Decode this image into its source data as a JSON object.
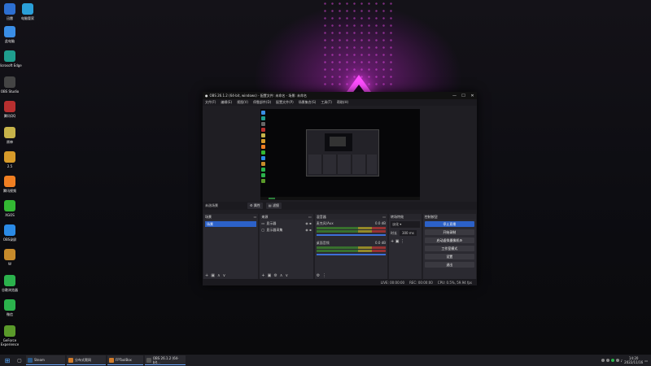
{
  "desktop": {
    "icons": [
      {
        "label": "此电脑",
        "color": "#3a8ee6"
      },
      {
        "label": "Microsoft Edge",
        "color": "#1f9e8e"
      },
      {
        "label": "OBS Studio",
        "color": "#444444"
      },
      {
        "label": "腾讯QQ",
        "color": "#b72f2f"
      },
      {
        "label": "原神",
        "color": "#c7b34a"
      },
      {
        "label": "2.5",
        "color": "#d79b2a"
      },
      {
        "label": "腾讯视频",
        "color": "#f07f22"
      },
      {
        "label": "XGOS",
        "color": "#33b833"
      },
      {
        "label": "OBS录屏",
        "color": "#2b8be6"
      },
      {
        "label": "W",
        "color": "#c78b2b"
      },
      {
        "label": "谷歌浏览器",
        "color": "#2bb24c"
      },
      {
        "label": "微信",
        "color": "#2bb24c"
      },
      {
        "label": "GeForce Experience",
        "color": "#5a9a2a"
      }
    ],
    "top_icons": [
      {
        "label": "迅雷",
        "color": "#2d6fd1"
      },
      {
        "label": "电脑管家",
        "color": "#2a9fd8"
      }
    ]
  },
  "obs": {
    "title": "OBS 26.1.2 (64-bit, windows) - 配置文件: 未命名 - 场景: 未命名",
    "window_controls": [
      "—",
      "☐",
      "✕"
    ],
    "menu": [
      "文件(F)",
      "编辑(E)",
      "视图(V)",
      "停靠部件(D)",
      "配置文件(P)",
      "场景集合(S)",
      "工具(T)",
      "帮助(H)"
    ],
    "scene_label": "未选场景",
    "props_button": "属性",
    "filter_button": "滤镜",
    "docks": {
      "scenes": {
        "title": "场景",
        "items": [
          "场景"
        ]
      },
      "sources": {
        "title": "来源",
        "items": [
          {
            "icon": "monitor",
            "label": "显示器"
          },
          {
            "icon": "window",
            "label": "显示器采集"
          }
        ]
      },
      "mixer": {
        "title": "混音器",
        "channels": [
          {
            "name": "麦克风/Aux",
            "db": "0.0 dB"
          },
          {
            "name": "桌面音频",
            "db": "0.0 dB"
          }
        ]
      },
      "transitions": {
        "title": "转场特效",
        "selected": "淡化",
        "duration_label": "时长",
        "duration": "300 ms"
      },
      "controls": {
        "title": "控制按钮",
        "buttons": [
          "停止直播",
          "开始录制",
          "启动虚拟摄像机",
          "工作室模式",
          "设置",
          "退出"
        ]
      }
    },
    "status": {
      "live": "LIVE: 00:00:00",
      "rec": "REC: 00:00:00",
      "cpu": "CPU: 0.5%, 59.94 fps"
    }
  },
  "taskbar": {
    "items": [
      {
        "label": "Steam",
        "color": "#2a5a8a"
      },
      {
        "label": "分布式爬网",
        "color": "#d07b2a"
      },
      {
        "label": "FPToolBox",
        "color": "#d07b2a"
      },
      {
        "label": "OBS 26.1.2 (64-bit...",
        "color": "#555555"
      }
    ],
    "time": "14:20",
    "date": "2022/11/16"
  }
}
